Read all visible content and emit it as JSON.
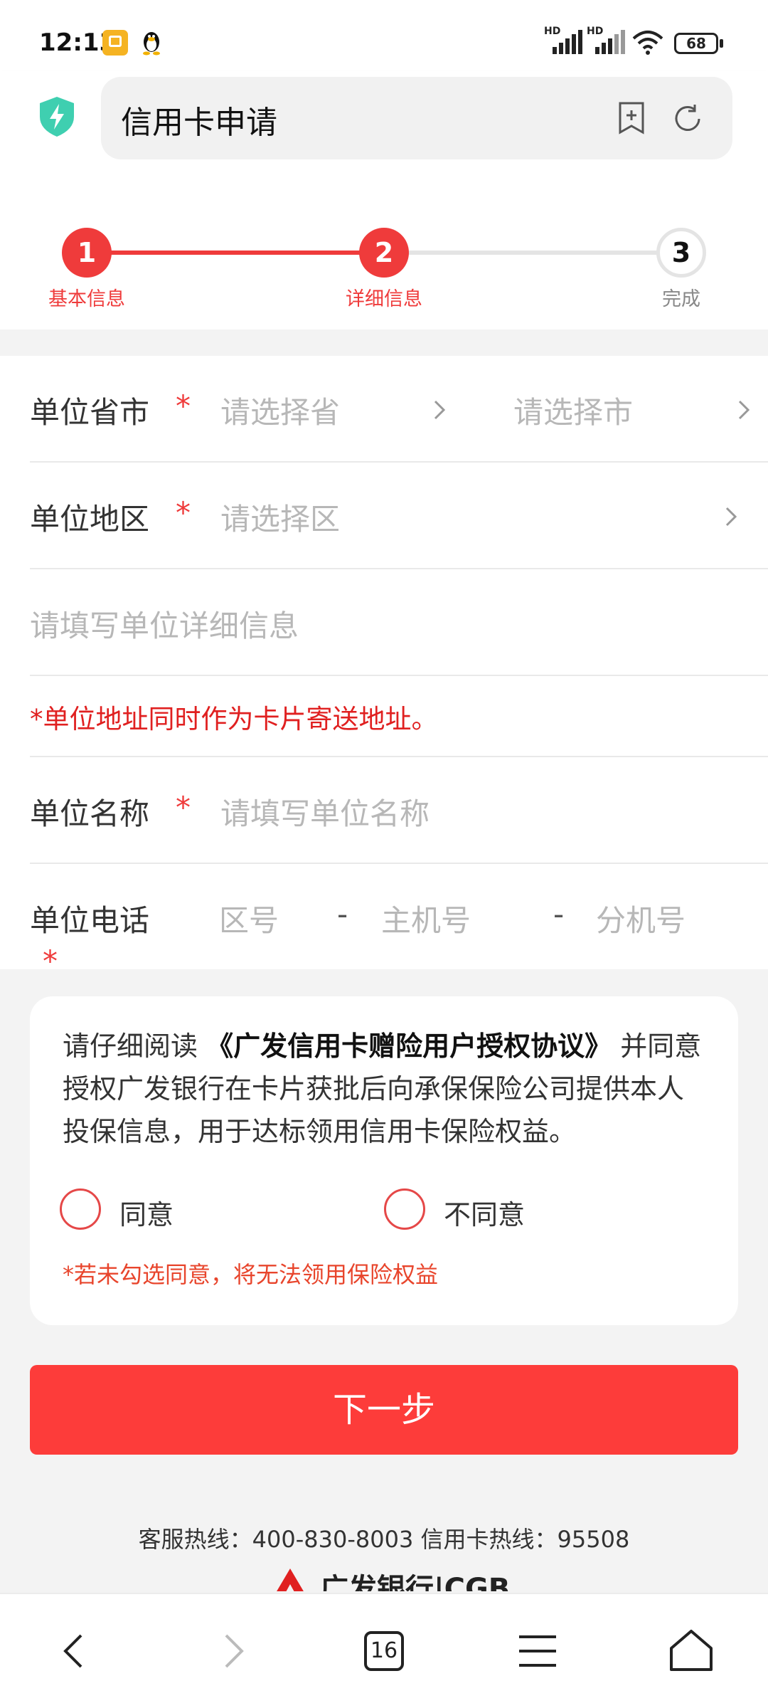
{
  "status_bar": {
    "time": "12:13",
    "signal_1": "HD",
    "signal_2": "HD",
    "battery": "68"
  },
  "address_bar": {
    "title": "信用卡申请",
    "icons": [
      "shield-bolt-icon",
      "bookmark-add-icon",
      "refresh-icon"
    ]
  },
  "stepper": {
    "steps": [
      {
        "number": "1",
        "label": "基本信息",
        "state": "done"
      },
      {
        "number": "2",
        "label": "详细信息",
        "state": "active"
      },
      {
        "number": "3",
        "label": "完成",
        "state": "pending"
      }
    ],
    "active_color": "#ef3b3b",
    "pending_color": "#e4e4e4"
  },
  "form": {
    "province_city": {
      "label": "单位省市",
      "required": "*",
      "province_placeholder": "请选择省",
      "city_placeholder": "请选择市"
    },
    "district": {
      "label": "单位地区",
      "required": "*",
      "placeholder": "请选择区"
    },
    "detail_address": {
      "placeholder": "请填写单位详细信息"
    },
    "address_note": "*单位地址同时作为卡片寄送地址。",
    "company_name": {
      "label": "单位名称",
      "required": "*",
      "placeholder": "请填写单位名称"
    },
    "company_phone": {
      "label": "单位电话",
      "required": "*",
      "area_placeholder": "区号",
      "main_placeholder": "主机号",
      "ext_placeholder": "分机号",
      "separator": "-"
    }
  },
  "consent": {
    "text_prefix": "请仔细阅读 ",
    "agreement_title": "《广发信用卡赠险用户授权协议》",
    "text_suffix": " 并同意授权广发银行在卡片获批后向承保保险公司提供本人投保信息，用于达标领用信用卡保险权益。",
    "agree_label": "同意",
    "disagree_label": "不同意",
    "warning": "*若未勾选同意，将无法领用保险权益"
  },
  "next_button": "下一步",
  "footer": {
    "hotline": "客服热线：400-830-8003    信用卡热线：95508",
    "brand": "广发银行|CGB"
  },
  "bottom_nav": {
    "tab_count": "16",
    "icons": [
      "back-icon",
      "forward-icon",
      "tabs-icon",
      "menu-icon",
      "home-icon"
    ]
  },
  "colors": {
    "brand_red": "#fd3c3a",
    "required_red": "#ef3b3b",
    "shield_teal": "#3fcfb0"
  }
}
